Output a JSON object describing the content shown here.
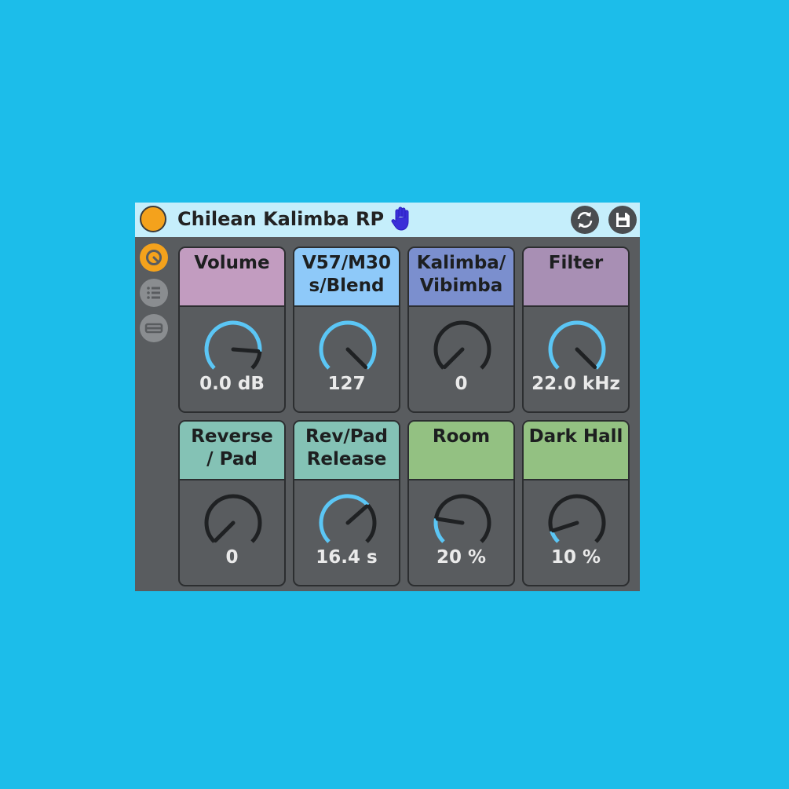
{
  "device": {
    "title": "Chilean Kalimba RP",
    "icons": {
      "power": "power-toggle",
      "hand": "hand-icon",
      "refresh": "refresh-icon",
      "save": "save-icon",
      "sidebar": [
        "macro-dial-icon",
        "list-icon",
        "collapse-icon"
      ]
    },
    "colors": {
      "background": "#1cbdea",
      "device_body": "#595c5f",
      "title_bar": "#c5eefb",
      "power_on": "#f4a21c",
      "knob_active": "#5bc6f5",
      "knob_track": "#1f2123"
    }
  },
  "macros": [
    {
      "label": "Volume",
      "value": "0.0 dB",
      "level": 0.85,
      "color": "#c29cc0"
    },
    {
      "label": "V57/M30\ns/Blend",
      "value": "127",
      "level": 1.0,
      "color": "#8ec9f9"
    },
    {
      "label": "Kalimba/\nVibimba",
      "value": "0",
      "level": 0.0,
      "color": "#7b8fce"
    },
    {
      "label": "Filter",
      "value": "22.0 kHz",
      "level": 1.0,
      "color": "#a88fb4"
    },
    {
      "label": "Reverse\n/ Pad",
      "value": "0",
      "level": 0.0,
      "color": "#84c2b5"
    },
    {
      "label": "Rev/Pad\nRelease",
      "value": "16.4 s",
      "level": 0.68,
      "color": "#84c2b5"
    },
    {
      "label": "Room",
      "value": "20 %",
      "level": 0.2,
      "color": "#93c182"
    },
    {
      "label": "Dark Hall",
      "value": "10 %",
      "level": 0.1,
      "color": "#93c182"
    }
  ]
}
